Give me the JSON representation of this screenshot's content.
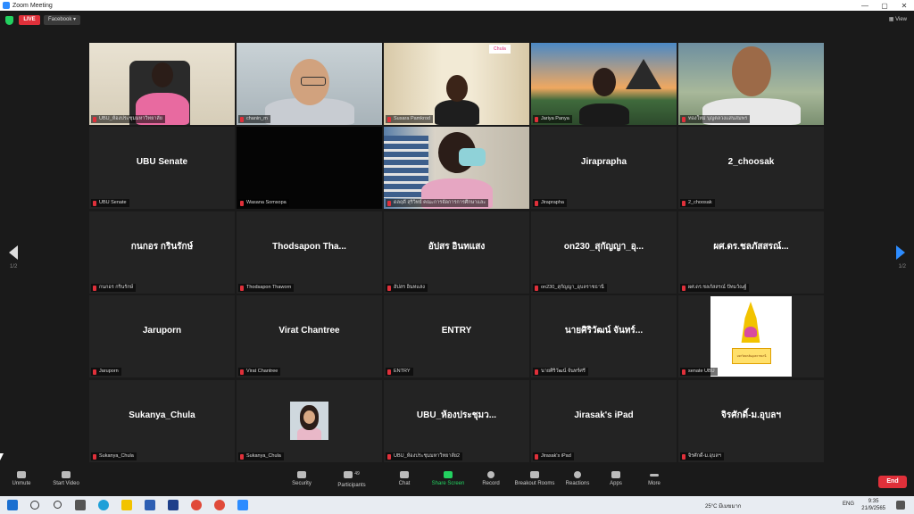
{
  "window": {
    "title": "Zoom Meeting",
    "minimize": "—",
    "maximize": "▢",
    "close": "✕"
  },
  "topbar": {
    "live": "LIVE",
    "stream_target": "Facebook ▾",
    "view": "View"
  },
  "pager": {
    "left": "1/2",
    "right": "1/2"
  },
  "tiles": [
    {
      "label": "UBU_ห้องประชุมมหาวิทยาลัย"
    },
    {
      "label": "chanin_m"
    },
    {
      "label": "Susara Pamkrod"
    },
    {
      "label": "Jariya Panya"
    },
    {
      "label": "ทองใหม่ บุญตลวงแสนสมพร"
    },
    {
      "display": "UBU Senate",
      "label": "UBU Senate"
    },
    {
      "label": "Wasana Somsopa"
    },
    {
      "label": "ดลฤดี สุริวิทย์ คณะการจัดการการศึกษาและ"
    },
    {
      "display": "Jiraprapha",
      "label": "Jiraprapha"
    },
    {
      "display": "2_choosak",
      "label": "2_choosak"
    },
    {
      "display": "กนกอร กรินรักษ์",
      "label": "กนกอร กรินรักษ์"
    },
    {
      "display": "Thodsapon Tha...",
      "label": "Thodsapon Thaworn"
    },
    {
      "display": "อัปสร อินทแสง",
      "label": "อัปสร อินทแสง"
    },
    {
      "display": "on230_สุกัญญา_อุ...",
      "label": "on230_สุกัญญา_อุบลราชธานี"
    },
    {
      "display": "ผศ.ดร.ชลภัสสรณ์...",
      "label": "ผศ.ดร.ชลภัสสรณ์ ปัทมวัณฐ์"
    },
    {
      "display": "Jaruporn",
      "label": "Jaruporn"
    },
    {
      "display": "Virat Chantree",
      "label": "Virat Chantree"
    },
    {
      "display": "ENTRY",
      "label": "ENTRY"
    },
    {
      "display": "นายศิริวัฒน์ จันทร์...",
      "label": "นายศิริวัฒน์ จันทร์ศรี"
    },
    {
      "label": "senate UBU",
      "logo_text": "มหาวิทยาลัยอุบลราชธานี"
    },
    {
      "display": "Sukanya_Chula",
      "label": "Sukanya_Chula"
    },
    {
      "label": "Sukanya_Chula"
    },
    {
      "display": "UBU_ห้องประชุมว...",
      "label": "UBU_ห้องประชุมมหาวิทยาลัย2"
    },
    {
      "display": "Jirasak's iPad",
      "label": "Jirasak's iPad"
    },
    {
      "display": "จิรศักดิ์-ม.อุบลฯ",
      "label": "จิรศักดิ์-ม.อุบลฯ"
    }
  ],
  "chula_sign": "Chula",
  "toolbar": {
    "unmute": "Unmute",
    "start_video": "Start Video",
    "security": "Security",
    "participants": "Participants",
    "participants_count": "49",
    "chat": "Chat",
    "share": "Share Screen",
    "record": "Record",
    "breakout": "Breakout Rooms",
    "reactions": "Reactions",
    "apps": "Apps",
    "more": "More",
    "end": "End"
  },
  "taskbar": {
    "weather": "25°C มีเมฆมาก",
    "lang": "ENG",
    "time": "9:35",
    "date": "21/9/2565"
  },
  "colors": {
    "live": "#e0303a",
    "share": "#23d160",
    "accent": "#2d8cff",
    "active_speaker": "#f2e600"
  }
}
